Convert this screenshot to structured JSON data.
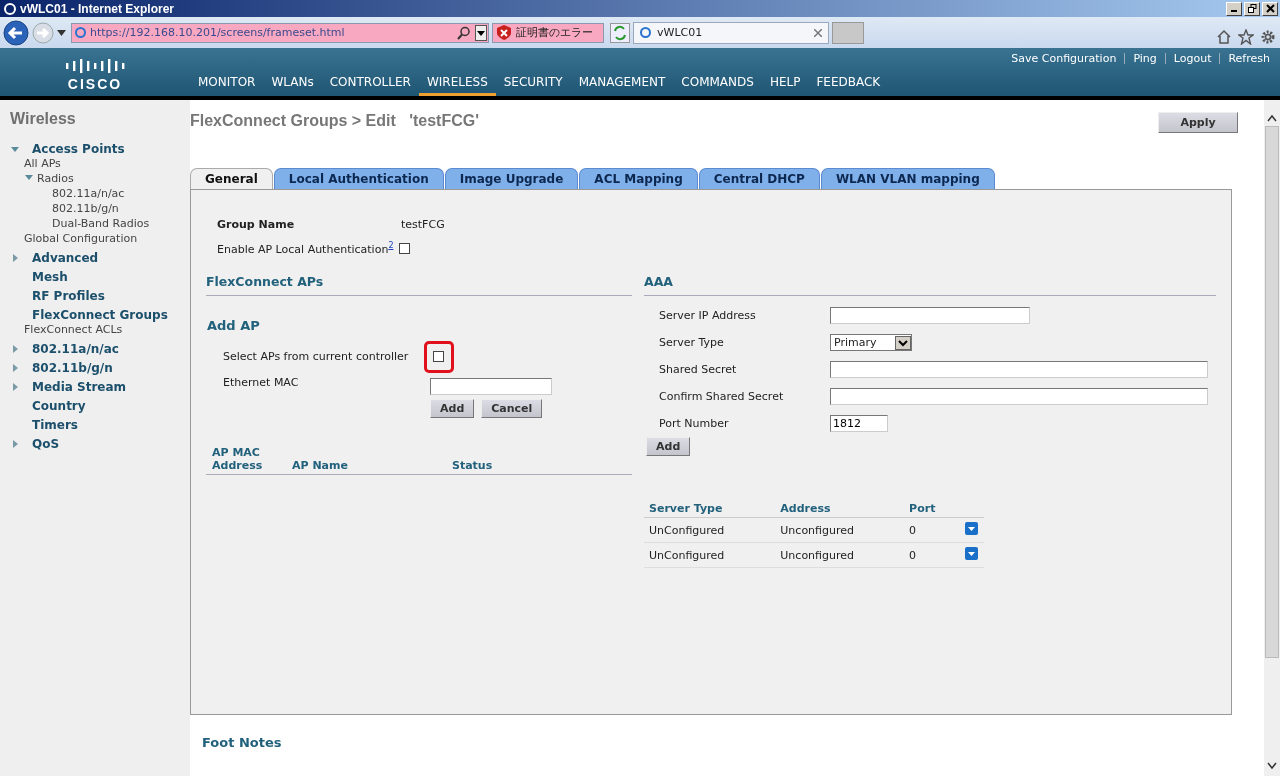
{
  "window": {
    "title": "vWLC01 - Internet Explorer"
  },
  "browser": {
    "url": "https://192.168.10.201/screens/frameset.html",
    "cert_error": "証明書のエラー",
    "tab": "vWLC01"
  },
  "header": {
    "logo": "CISCO",
    "top_links": [
      "Save Configuration",
      "Ping",
      "Logout",
      "Refresh"
    ],
    "nav": [
      {
        "label": "MONITOR",
        "selected": false
      },
      {
        "label": "WLANs",
        "selected": false
      },
      {
        "label": "CONTROLLER",
        "selected": false
      },
      {
        "label": "WIRELESS",
        "selected": true
      },
      {
        "label": "SECURITY",
        "selected": false
      },
      {
        "label": "MANAGEMENT",
        "selected": false
      },
      {
        "label": "COMMANDS",
        "selected": false
      },
      {
        "label": "HELP",
        "selected": false
      },
      {
        "label": "FEEDBACK",
        "selected": false
      }
    ]
  },
  "sidebar": {
    "title": "Wireless",
    "items": [
      {
        "label": "Access Points",
        "expanded": true,
        "children": [
          {
            "label": "All APs"
          },
          {
            "label": "Radios",
            "expanded": true,
            "children": [
              {
                "label": "802.11a/n/ac"
              },
              {
                "label": "802.11b/g/n"
              },
              {
                "label": "Dual-Band Radios"
              }
            ]
          },
          {
            "label": "Global Configuration"
          }
        ]
      },
      {
        "label": "Advanced",
        "expanded": false
      },
      {
        "label": "Mesh"
      },
      {
        "label": "RF Profiles"
      },
      {
        "label": "FlexConnect Groups",
        "children": [
          {
            "label": "FlexConnect ACLs"
          }
        ]
      },
      {
        "label": "802.11a/n/ac",
        "expanded": false
      },
      {
        "label": "802.11b/g/n",
        "expanded": false
      },
      {
        "label": "Media Stream",
        "expanded": false
      },
      {
        "label": "Country"
      },
      {
        "label": "Timers"
      },
      {
        "label": "QoS",
        "expanded": false
      }
    ]
  },
  "page": {
    "title": "FlexConnect Groups > Edit   'testFCG'",
    "apply": "Apply"
  },
  "tabs": [
    {
      "label": "General",
      "selected": true
    },
    {
      "label": "Local Authentication",
      "selected": false
    },
    {
      "label": "Image Upgrade",
      "selected": false
    },
    {
      "label": "ACL Mapping",
      "selected": false
    },
    {
      "label": "Central DHCP",
      "selected": false
    },
    {
      "label": "WLAN VLAN mapping",
      "selected": false
    }
  ],
  "general": {
    "group_name_label": "Group Name",
    "group_name": "testFCG",
    "local_auth_label": "Enable AP Local Authentication$^{2}$",
    "local_auth_checked": false
  },
  "flexconnect_aps": {
    "title": "FlexConnect APs",
    "add_title": "Add AP",
    "select_label": "Select APs from current controller",
    "select_checked": false,
    "select_highlighted": true,
    "mac_label": "Ethernet MAC",
    "buttons": [
      "Add",
      "Cancel"
    ],
    "columns": [
      "AP MAC Address",
      "AP Name",
      "Status"
    ]
  },
  "aaa": {
    "title": "AAA",
    "fields": [
      {
        "label": "Server IP Address",
        "kind": "field"
      },
      {
        "label": "Server Type",
        "kind": "select",
        "value": "Primary"
      },
      {
        "label": "Shared Secret",
        "kind": "wide-field"
      },
      {
        "label": "Confirm Shared Secret",
        "kind": "wide-field"
      },
      {
        "label": "Port Number",
        "kind": "small-field",
        "value": "1812"
      }
    ],
    "add": "Add",
    "columns": [
      "Server Type",
      "Address",
      "Port"
    ],
    "rows": [
      [
        "UnConfigured",
        "Unconfigured",
        "0"
      ],
      [
        "UnConfigured",
        "Unconfigured",
        "0"
      ]
    ]
  },
  "footer": {
    "title": "Foot Notes"
  }
}
